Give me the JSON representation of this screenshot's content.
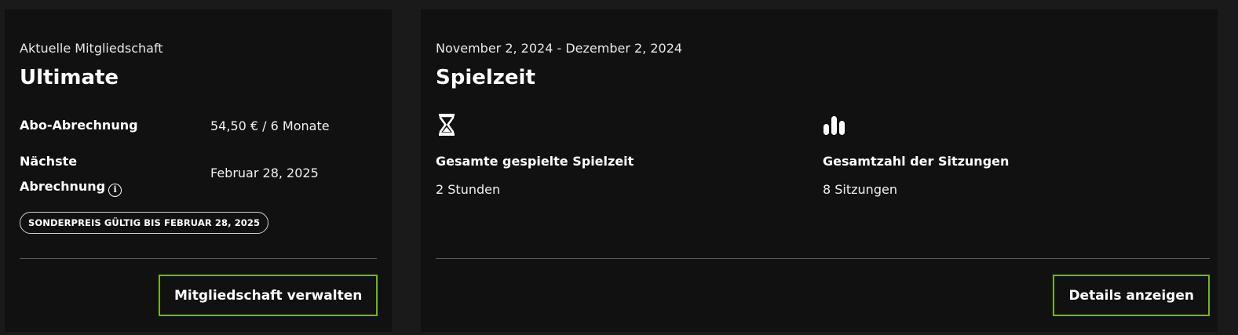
{
  "membership": {
    "eyebrow": "Aktuelle Mitgliedschaft",
    "plan": "Ultimate",
    "billing_label": "Abo-Abrechnung",
    "billing_value": "54,50 € / 6 Monate",
    "next_billing_label_line1": "Nächste",
    "next_billing_label_line2": "Abrechnung",
    "next_billing_value": "Februar 28, 2025",
    "promo_badge": "SONDERPREIS GÜLTIG BIS FEBRUAR 28, 2025",
    "manage_button": "Mitgliedschaft verwalten",
    "info_icon": "info-icon"
  },
  "playtime": {
    "date_range": "November 2, 2024 - Dezember 2, 2024",
    "title": "Spielzeit",
    "total_time_icon": "hourglass-icon",
    "total_time_label": "Gesamte gespielte Spielzeit",
    "total_time_value": "2 Stunden",
    "sessions_icon": "bar-chart-icon",
    "sessions_label": "Gesamtzahl der Sitzungen",
    "sessions_value": "8 Sitzungen",
    "details_button": "Details anzeigen"
  },
  "colors": {
    "page_bg": "#1a1a1a",
    "card_bg": "#111111",
    "accent": "#76b900",
    "divider": "#5a5a5a"
  }
}
